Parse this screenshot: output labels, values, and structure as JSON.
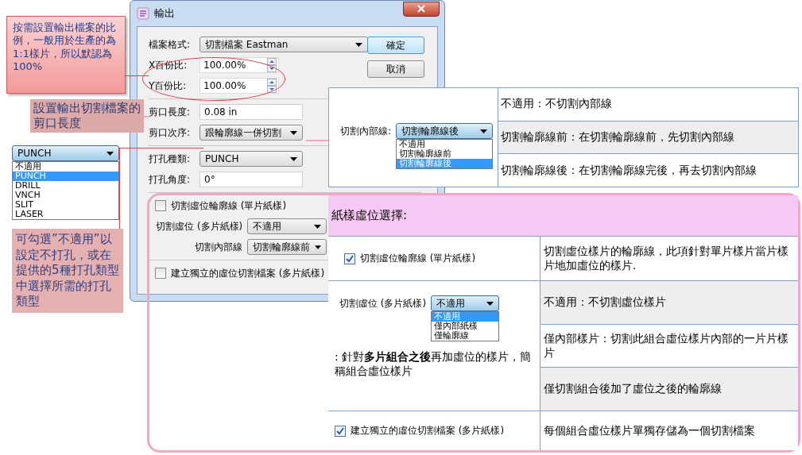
{
  "dialog": {
    "title": "輸出",
    "groups": [
      [
        {
          "kind": "dropdown",
          "label": "檔案格式:",
          "value": "切割檔案 Eastman"
        },
        {
          "kind": "spin",
          "label": "X百份比:",
          "value": "100.00%"
        },
        {
          "kind": "spin",
          "label": "Y百份比:",
          "value": "100.00%"
        }
      ],
      [
        {
          "kind": "text",
          "label": "剪口長度:",
          "value": "0.08 in"
        },
        {
          "kind": "dropdown",
          "label": "剪口次序:",
          "value": "跟輪廓線一併切割"
        }
      ],
      [
        {
          "kind": "dropdown",
          "label": "打孔種類:",
          "value": "PUNCH"
        },
        {
          "kind": "text",
          "label": "打孔角度:",
          "value": "0°"
        }
      ],
      [
        {
          "kind": "checkbox",
          "label": "切割虛位輪廓線 (單片紙樣)",
          "checked": false
        },
        {
          "kind": "dropdown",
          "label": "切割虛位 (多片紙樣)",
          "value": "不適用"
        },
        {
          "kind": "dropdown",
          "label": "切割內部線",
          "value": "切割輪廓線前"
        }
      ],
      [
        {
          "kind": "checkbox",
          "label": "建立獨立的虛位切割檔案 (多片紙樣)",
          "checked": false
        }
      ]
    ],
    "buttons": [
      {
        "label": "確定",
        "default": true
      },
      {
        "label": "取消",
        "default": false
      }
    ]
  },
  "callouts": {
    "scale_note": "按需設置輸出檔案的比例，一般用於生產的為1:1樣片，所以默認為100%",
    "notch_note": "設置輸出切割檔案的剪口長度",
    "punch_note": "可勾選”不適用”以設定不打孔，或在提供的5種打孔類型中選擇所需的打孔類型"
  },
  "punch_dropdown": {
    "value": "PUNCH",
    "options": [
      {
        "label": "不適用",
        "selected": false
      },
      {
        "label": "PUNCH",
        "selected": true
      },
      {
        "label": "DRILL",
        "selected": false
      },
      {
        "label": "VNCH",
        "selected": false
      },
      {
        "label": "SLIT",
        "selected": false
      },
      {
        "label": "LASER",
        "selected": false
      }
    ]
  },
  "inner_line_table": {
    "label": "切割內部線:",
    "value": "切割輪廓線後",
    "options": [
      {
        "label": "不適用",
        "selected": false
      },
      {
        "label": "切割輪廓線前",
        "selected": false
      },
      {
        "label": "切割輪廓線後",
        "selected": true
      }
    ],
    "rows": [
      "不適用：不切割內部線",
      "切割輪廓線前：在切割輪廓線前，先切割內部線",
      "切割輪廓線後：在切割輪廓線完後，再去切割內部線"
    ]
  },
  "bleed_table": {
    "title": "紙樣虛位選擇:",
    "rows": [
      {
        "kind": "checkbox",
        "label": "切割虛位輪廓線 (單片紙樣)",
        "checked": true,
        "descriptions": [
          "切割虛位樣片的輪廓線，此項針對單片樣片當片樣片地加虛位的樣片."
        ]
      },
      {
        "kind": "dropdown",
        "label": "切割虛位 (多片紙樣)",
        "value": "不適用",
        "options": [
          {
            "label": "不適用",
            "selected": true
          },
          {
            "label": "僅內部紙樣",
            "selected": false
          },
          {
            "label": "僅輪廓線",
            "selected": false
          }
        ],
        "note": ": 針對**多片組合之後**再加虛位的樣片，簡稱組合虛位樣片",
        "descriptions": [
          "不適用：不切割虛位樣片",
          "僅內部樣片：切割此組合虛位樣片內部的一片片樣片",
          "僅切割組合後加了虛位之後的輪廓線"
        ]
      },
      {
        "kind": "checkbox",
        "label": "建立獨立的虛位切割檔案 (多片紙樣)",
        "checked": true,
        "descriptions": [
          "每個組合虛位樣片單獨存儲為一個切割檔案"
        ]
      }
    ]
  }
}
